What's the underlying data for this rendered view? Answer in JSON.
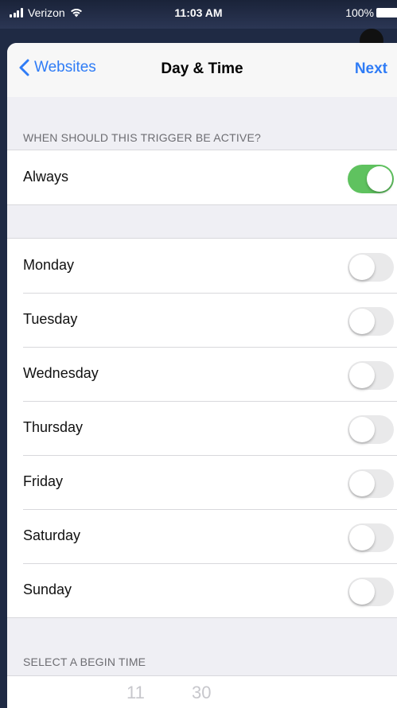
{
  "status_bar": {
    "carrier": "Verizon",
    "time": "11:03 AM",
    "battery": "100%"
  },
  "nav": {
    "back_label": "Websites",
    "title": "Day & Time",
    "next_label": "Next"
  },
  "sections": {
    "active_header": "WHEN SHOULD THIS TRIGGER BE ACTIVE?",
    "begin_time_header": "SELECT A BEGIN TIME"
  },
  "always": {
    "label": "Always",
    "on": true
  },
  "days": [
    {
      "label": "Monday",
      "on": false
    },
    {
      "label": "Tuesday",
      "on": false
    },
    {
      "label": "Wednesday",
      "on": false
    },
    {
      "label": "Thursday",
      "on": false
    },
    {
      "label": "Friday",
      "on": false
    },
    {
      "label": "Saturday",
      "on": false
    },
    {
      "label": "Sunday",
      "on": false
    }
  ],
  "picker": {
    "hour": "11",
    "minute": "30"
  },
  "colors": {
    "accent": "#2f7cf6",
    "toggle_on": "#5fc25f",
    "toggle_off": "#e9e9ea"
  }
}
